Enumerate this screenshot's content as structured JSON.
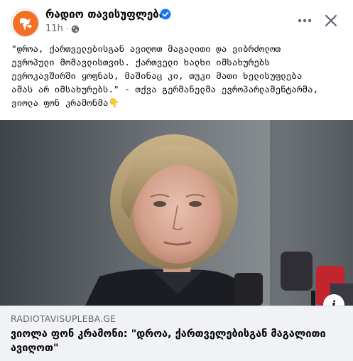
{
  "header": {
    "page_name": "რადიო თავისუფლება",
    "time": "11h",
    "separator": "·",
    "verified_icon": "verified-badge-icon",
    "privacy_icon": "globe-icon",
    "more_icon": "more-horizontal-icon",
    "close_icon": "close-icon"
  },
  "post": {
    "text": "\"დროა, ქართველებისგან ავიღოთ მაგალითი და ვიბრძოლოთ\nევროპული მომავლისთვის. ქართველი ხალხი იმსახურებს\nევროკავშირში ყოფნას, მაშინაც კი, თუკი მათი ხელისუფლება\nამას არ იმსახურებს.\" - თქვა გერმანელმა ევროპარლამენტარმა,\nვიოლა ფონ კრამონმა👇"
  },
  "link_preview": {
    "domain": "RADIOTAVISUPLEBA.GE",
    "title": "ვიოლა ფონ კრამონი: \"დროა, ქართველებისგან მაგალითი ავიღოთ\"",
    "info_label": "i"
  },
  "colors": {
    "brand_orange": "#f36f21",
    "verified_blue": "#1877f2",
    "secondary_text": "#65676b",
    "link_bg": "#f0f2f5"
  }
}
